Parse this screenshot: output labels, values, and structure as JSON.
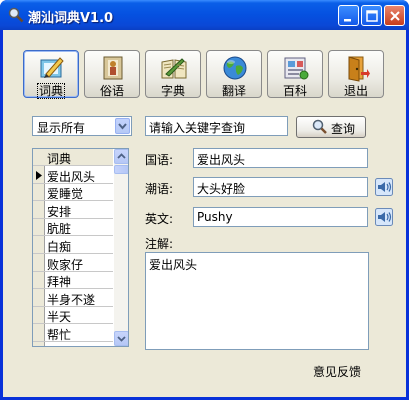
{
  "window": {
    "title": "潮汕词典V1.0"
  },
  "toolbar": {
    "buttons": [
      {
        "label": "词典",
        "icon": "dictionary-pen-icon",
        "active": true
      },
      {
        "label": "俗语",
        "icon": "book-figure-icon",
        "active": false
      },
      {
        "label": "字典",
        "icon": "open-book-icon",
        "active": false
      },
      {
        "label": "翻译",
        "icon": "globe-icon",
        "active": false
      },
      {
        "label": "百科",
        "icon": "encyclopedia-icon",
        "active": false
      },
      {
        "label": "退出",
        "icon": "exit-door-icon",
        "active": false
      }
    ]
  },
  "filter": {
    "selected": "显示所有"
  },
  "search": {
    "value": "请输入关键字查询",
    "button_label": "查询"
  },
  "list": {
    "header": "词典",
    "items": [
      "爱出风头",
      "爱睡觉",
      "安排",
      "肮脏",
      "白痴",
      "败家仔",
      "拜神",
      "半身不遂",
      "半天",
      "帮忙"
    ],
    "selected_index": 0
  },
  "detail": {
    "mandarin_label": "国语:",
    "mandarin_value": "爱出风头",
    "chaoshan_label": "潮语:",
    "chaoshan_value": "大头好脸",
    "english_label": "英文:",
    "english_value": "Pushy",
    "notes_label": "注解:",
    "notes_value": "爱出风头"
  },
  "footer": {
    "feedback_label": "意见反馈"
  },
  "colors": {
    "title_bar": "#0550e0",
    "client_bg": "#ece9d8",
    "input_border": "#7f9db9"
  }
}
